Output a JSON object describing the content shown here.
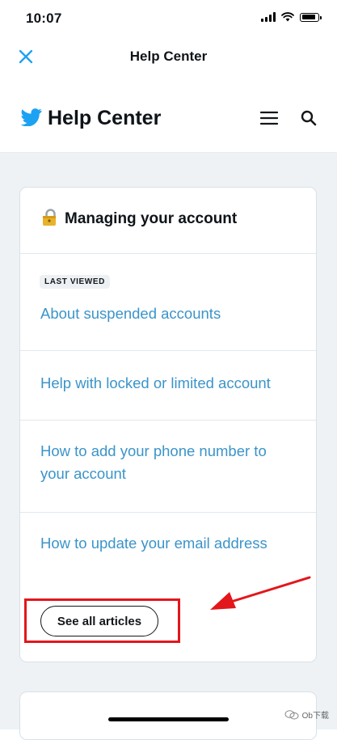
{
  "status_bar": {
    "time": "10:07"
  },
  "nav": {
    "title": "Help Center"
  },
  "header": {
    "title": "Help Center"
  },
  "card": {
    "title": "Managing your account",
    "badge": "LAST VIEWED",
    "articles": [
      {
        "label": "About suspended accounts"
      },
      {
        "label": "Help with locked or limited account"
      },
      {
        "label": "How to add your phone number to your account"
      },
      {
        "label": "How to update your email address"
      }
    ],
    "see_all_label": "See all articles"
  },
  "colors": {
    "link": "#3b94c9",
    "brand": "#1da1f2",
    "highlight": "#e3161b",
    "background": "#eef2f5"
  },
  "icons": [
    "close-icon",
    "twitter-bird-logo",
    "menu-icon",
    "search-icon",
    "lock-icon"
  ],
  "watermark": {
    "text": "Ob下载"
  }
}
